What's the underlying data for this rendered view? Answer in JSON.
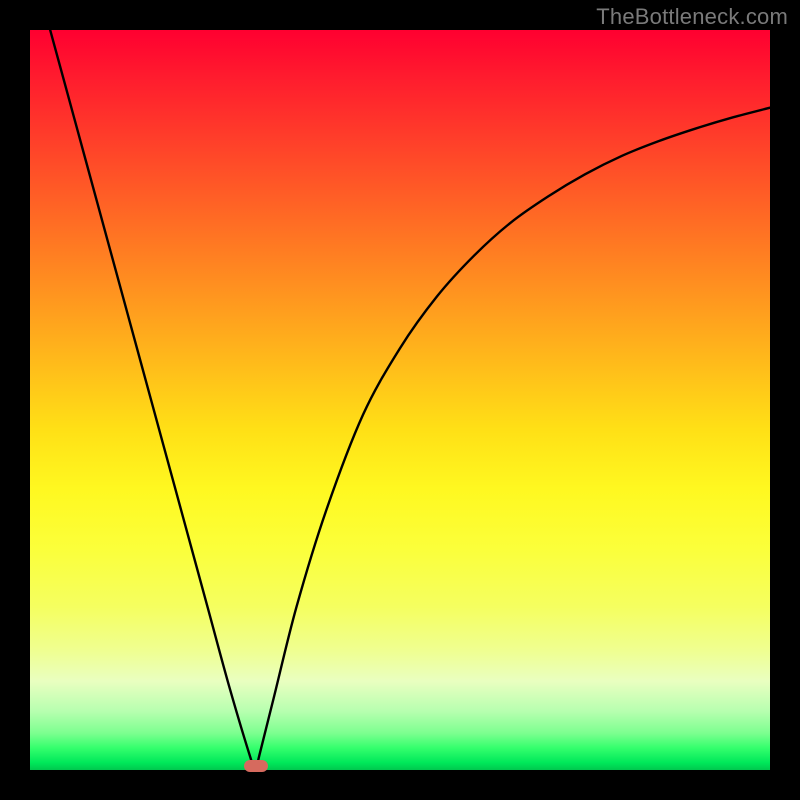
{
  "watermark": "TheBottleneck.com",
  "colors": {
    "curve_stroke": "#000000",
    "marker_fill": "#d66a5e"
  },
  "chart_data": {
    "type": "line",
    "title": "",
    "xlabel": "",
    "ylabel": "",
    "xlim": [
      0,
      100
    ],
    "ylim": [
      0,
      100
    ],
    "grid": false,
    "note": "Axes unlabeled; x roughly component-ratio percent, y roughly bottleneck percent. Values estimated from pixels.",
    "series": [
      {
        "name": "bottleneck-curve",
        "x": [
          0,
          3,
          6,
          9,
          12,
          15,
          18,
          21,
          24,
          27,
          30,
          30.5,
          31,
          33,
          36,
          40,
          45,
          50,
          55,
          60,
          65,
          70,
          75,
          80,
          85,
          90,
          95,
          100
        ],
        "y": [
          110,
          99,
          88,
          77,
          66,
          55,
          44,
          33,
          22,
          11,
          1,
          0,
          2,
          10,
          22,
          35,
          48,
          57,
          64,
          69.5,
          74,
          77.5,
          80.5,
          83,
          85,
          86.7,
          88.2,
          89.5
        ]
      }
    ],
    "annotations": [
      {
        "name": "optimal-marker",
        "x": 30.5,
        "y": 0.5
      }
    ]
  }
}
